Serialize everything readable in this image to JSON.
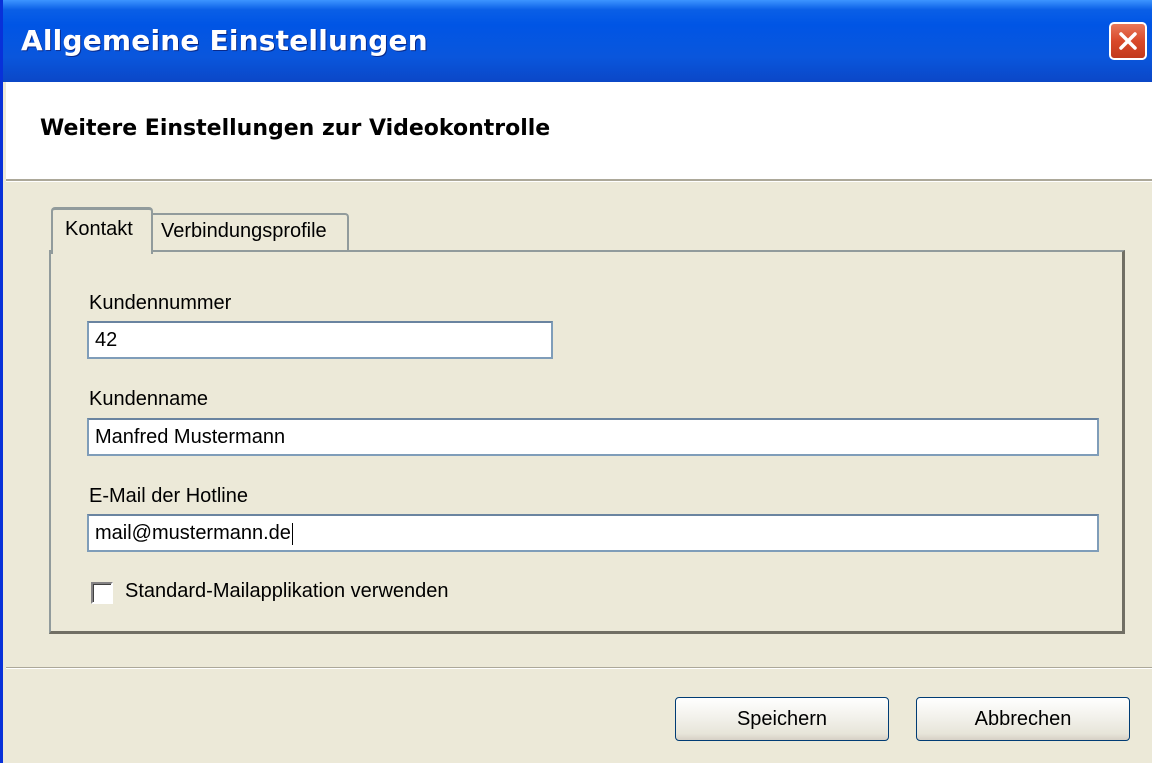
{
  "window": {
    "title": "Allgemeine Einstellungen",
    "close_icon": "close-x-icon"
  },
  "header": {
    "title": "Weitere Einstellungen zur Videokontrolle"
  },
  "tabs": [
    {
      "label": "Kontakt",
      "active": true
    },
    {
      "label": "Verbindungsprofile",
      "active": false
    }
  ],
  "form": {
    "kundennummer": {
      "label": "Kundennummer",
      "value": "42"
    },
    "kundenname": {
      "label": "Kundenname",
      "value": "Manfred Mustermann"
    },
    "email": {
      "label": "E-Mail der Hotline",
      "value": "mail@mustermann.de"
    },
    "checkbox": {
      "label": "Standard-Mailapplikation verwenden",
      "checked": false
    }
  },
  "buttons": {
    "save": "Speichern",
    "cancel": "Abbrechen"
  },
  "colors": {
    "titlebar": "#0055e5",
    "dialog_bg": "#ece9d8",
    "close_button": "#d9492a",
    "field_border": "#7f9db9"
  }
}
